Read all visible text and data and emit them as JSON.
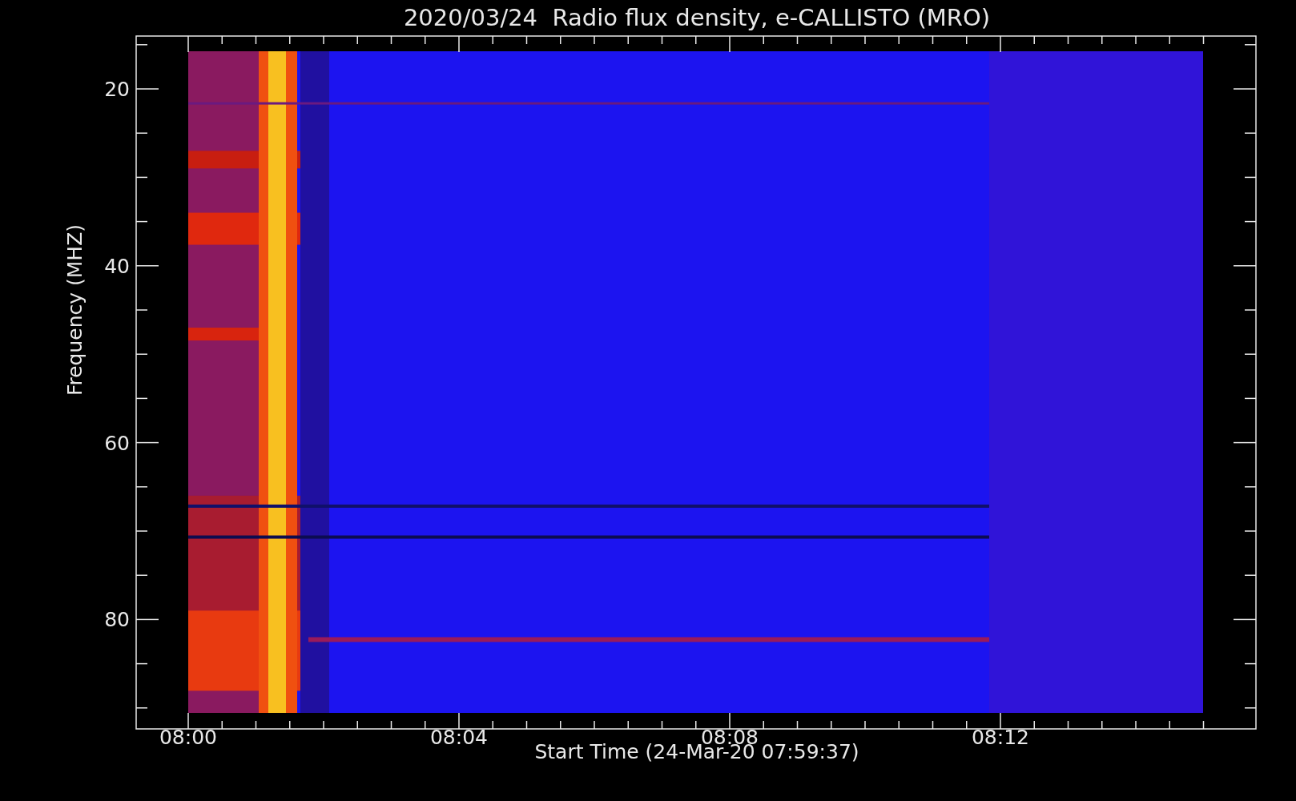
{
  "title": "2020/03/24  Radio flux density, e-CALLISTO (MRO)",
  "plot": {
    "ylabel": "Frequency (MHZ)",
    "xlabel": "Start Time (24-Mar-20 07:59:37)",
    "yticks": [
      "20",
      "40",
      "60",
      "80"
    ],
    "xticks": [
      "08:00",
      "08:04",
      "08:08",
      "08:12"
    ]
  }
}
